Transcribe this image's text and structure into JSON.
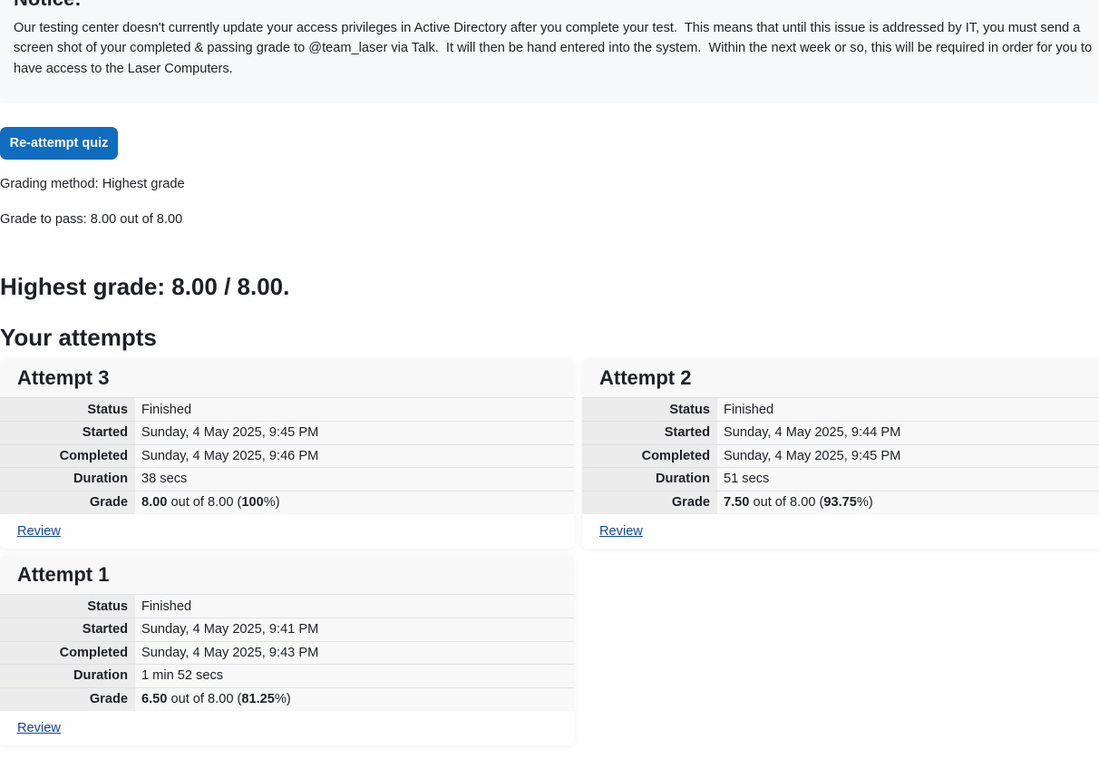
{
  "notice": {
    "title": "Notice:",
    "text": "Our testing center doesn't currently update your access privileges in Active Directory after you complete your test.  This means that until this issue is addressed by IT, you must send a screen shot of your completed & passing grade to @team_laser via Talk.  It will then be hand entered into the system.  Within the next week or so, this will be required in order for you to have access to the Laser Computers."
  },
  "actions": {
    "reattempt_label": "Re-attempt quiz"
  },
  "grading_method": "Grading method: Highest grade",
  "grade_to_pass": "Grade to pass: 8.00 out of 8.00",
  "highest_grade": "Highest grade: 8.00 / 8.00.",
  "attempts_heading": "Your attempts",
  "labels": {
    "status": "Status",
    "started": "Started",
    "completed": "Completed",
    "duration": "Duration",
    "grade": "Grade",
    "review": "Review"
  },
  "attempts": [
    {
      "title": "Attempt 3",
      "status": "Finished",
      "started": "Sunday, 4 May 2025, 9:45 PM",
      "completed": "Sunday, 4 May 2025, 9:46 PM",
      "duration": "38 secs",
      "grade_score": "8.00",
      "grade_mid": " out of 8.00 (",
      "grade_percent": "100",
      "grade_end": "%)"
    },
    {
      "title": "Attempt 2",
      "status": "Finished",
      "started": "Sunday, 4 May 2025, 9:44 PM",
      "completed": "Sunday, 4 May 2025, 9:45 PM",
      "duration": "51 secs",
      "grade_score": "7.50",
      "grade_mid": " out of 8.00 (",
      "grade_percent": "93.75",
      "grade_end": "%)"
    },
    {
      "title": "Attempt 1",
      "status": "Finished",
      "started": "Sunday, 4 May 2025, 9:41 PM",
      "completed": "Sunday, 4 May 2025, 9:43 PM",
      "duration": "1 min 52 secs",
      "grade_score": "6.50",
      "grade_mid": " out of 8.00 (",
      "grade_percent": "81.25",
      "grade_end": "%)"
    }
  ]
}
